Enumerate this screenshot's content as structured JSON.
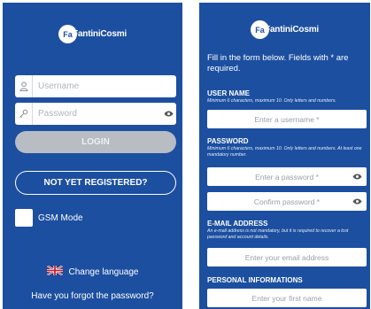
{
  "login": {
    "logo_text": "FantiniCosmi",
    "logo_badge": "Fa",
    "username_placeholder": "Username",
    "password_placeholder": "Password",
    "login_label": "LOGIN",
    "register_label": "NOT YET REGISTERED?",
    "gsm_label": "GSM Mode",
    "language_label": "Change language",
    "forgot_label": "Have you forgot the password?"
  },
  "register": {
    "logo_text": "FantiniCosmi",
    "logo_badge": "Fa",
    "intro": "Fill in the form below. Fields with * are required.",
    "username": {
      "title": "USER NAME",
      "hint": "Minimum 6 characters, maximum 10. Only letters and numbers.",
      "placeholder": "Enter a username *"
    },
    "password": {
      "title": "PASSWORD",
      "hint": "Minimum 6 characters, maximum 10. Only letters and numbers. At least one mandatory number.",
      "placeholder": "Enter a password *",
      "confirm_placeholder": "Confirm password *"
    },
    "email": {
      "title": "E-MAIL ADDRESS",
      "hint": "An e-mail address is not mandatory, but it is required to recover a lost password and account details.",
      "placeholder": "Enter your email address"
    },
    "personal": {
      "title": "PERSONAL INFORMATIONS",
      "firstname_placeholder": "Enter your first name"
    }
  },
  "colors": {
    "brand_blue": "#1c4fa0",
    "disabled_button": "#b8bcc3"
  },
  "icons": [
    "user-icon",
    "key-icon",
    "eye-icon",
    "uk-flag-icon"
  ]
}
